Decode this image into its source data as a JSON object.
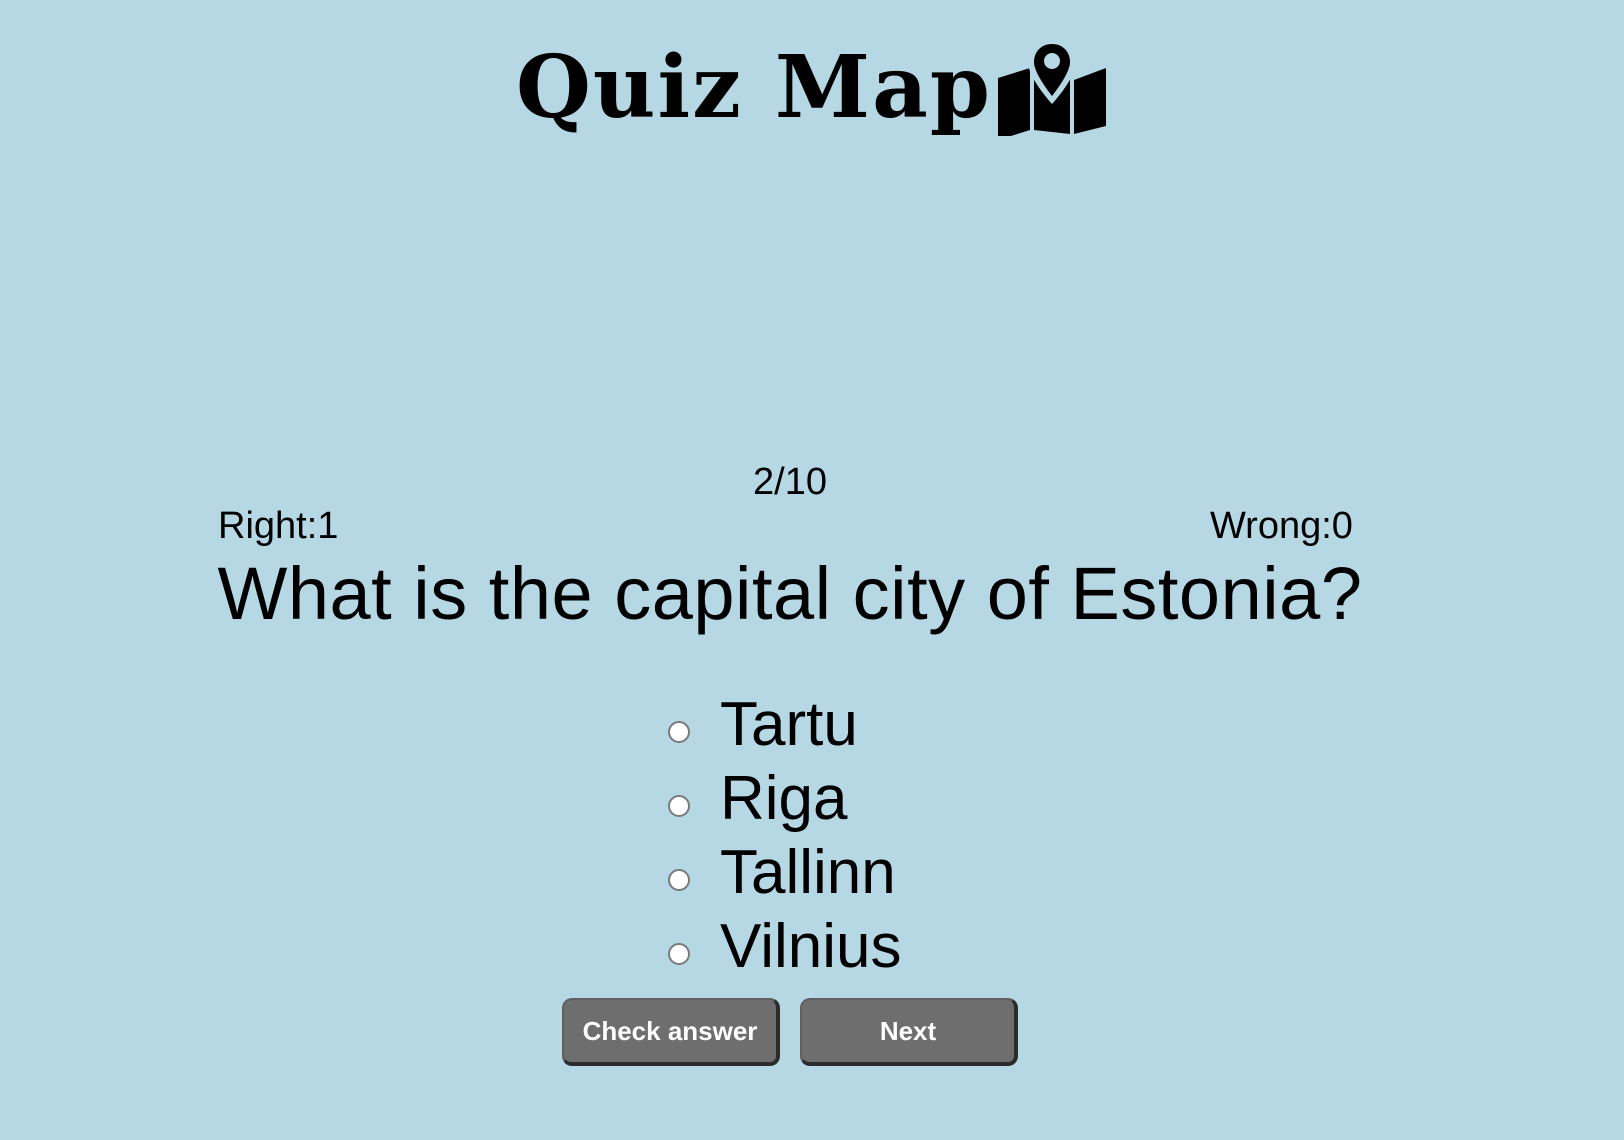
{
  "header": {
    "title": "Quiz Map",
    "logo_icon": "map-pin-icon"
  },
  "progress": {
    "counter": "2/10"
  },
  "score": {
    "right": "Right:1",
    "wrong": "Wrong:0"
  },
  "question": {
    "text": "What is the capital city of Estonia?"
  },
  "options": [
    {
      "label": "Tartu",
      "selected": false
    },
    {
      "label": "Riga",
      "selected": false
    },
    {
      "label": "Tallinn",
      "selected": false
    },
    {
      "label": "Vilnius",
      "selected": false
    }
  ],
  "buttons": {
    "check_label": "Check answer",
    "next_label": "Next"
  },
  "colors": {
    "background": "#b6d8e5",
    "button": "#6e6e6e",
    "button_text": "#ffffff"
  }
}
